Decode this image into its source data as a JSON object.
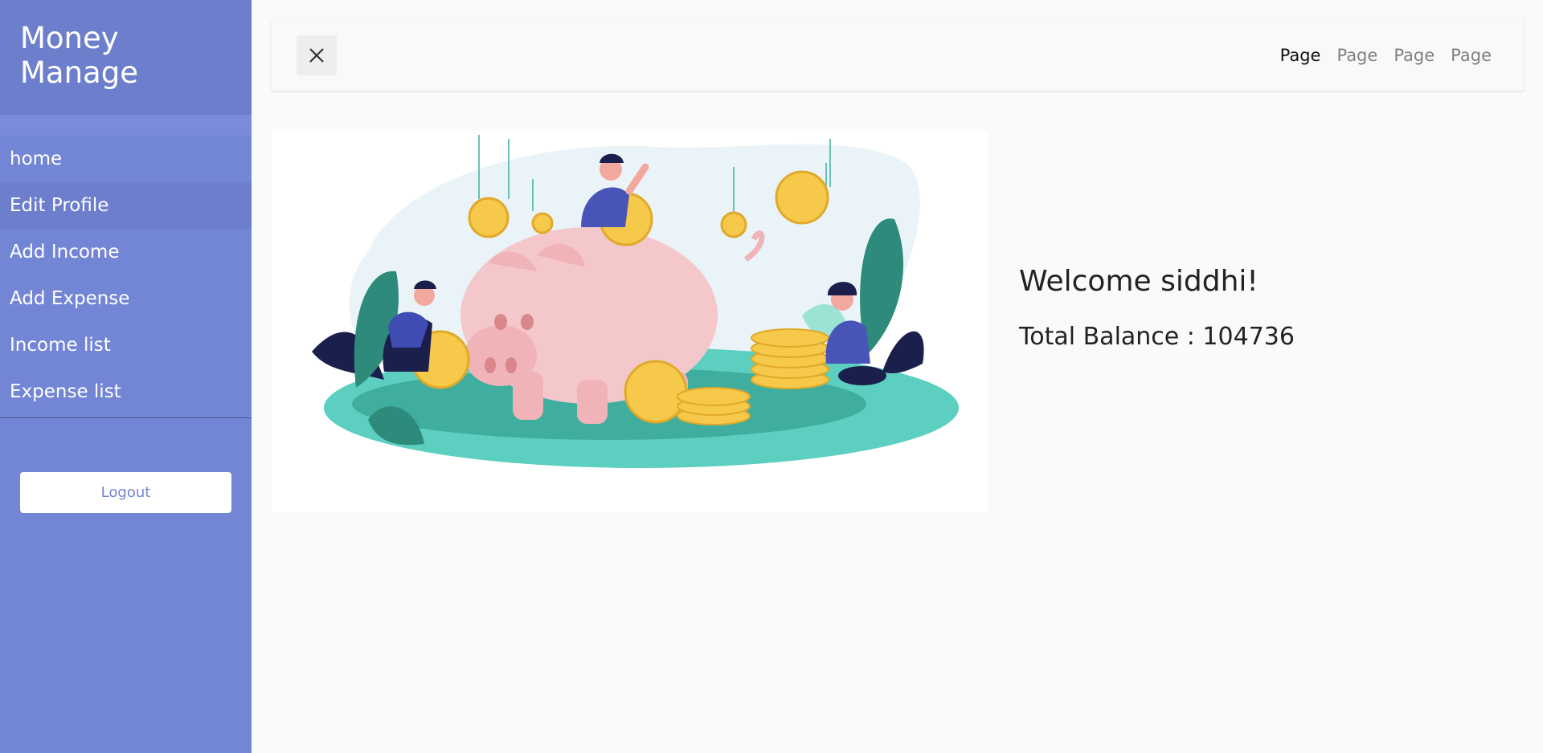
{
  "app": {
    "brand": "Money Manage"
  },
  "sidebar": {
    "items": [
      {
        "label": "home"
      },
      {
        "label": "Edit Profile"
      },
      {
        "label": "Add Income"
      },
      {
        "label": "Add Expense"
      },
      {
        "label": "Income list"
      },
      {
        "label": "Expense list"
      }
    ],
    "logout_label": "Logout"
  },
  "topbar": {
    "close_icon": "close-icon",
    "links": [
      {
        "label": "Page"
      },
      {
        "label": "Page"
      },
      {
        "label": "Page"
      },
      {
        "label": "Page"
      }
    ]
  },
  "main": {
    "welcome": "Welcome siddhi!",
    "balance": "Total Balance : 104736"
  },
  "colors": {
    "sidebar": "#7386d5",
    "sidebar_dark": "#6d7fcc",
    "coin": "#f6c94a",
    "pig": "#f4c8cb",
    "ground": "#5ccfc0"
  }
}
